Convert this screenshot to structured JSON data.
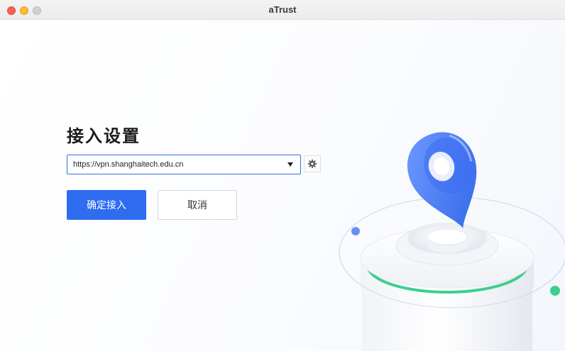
{
  "window": {
    "title": "aTrust"
  },
  "settings": {
    "heading": "接入设置",
    "url_value": "https://vpn.shanghaitech.edu.cn",
    "gear_icon": "gear-icon"
  },
  "actions": {
    "confirm_label": "确定接入",
    "cancel_label": "取消"
  },
  "colors": {
    "accent": "#2e6cf0",
    "close": "#fe5f57",
    "minimize": "#febc2e",
    "maximize": "#d0d0d0",
    "ring_green": "#3ccf8e"
  }
}
